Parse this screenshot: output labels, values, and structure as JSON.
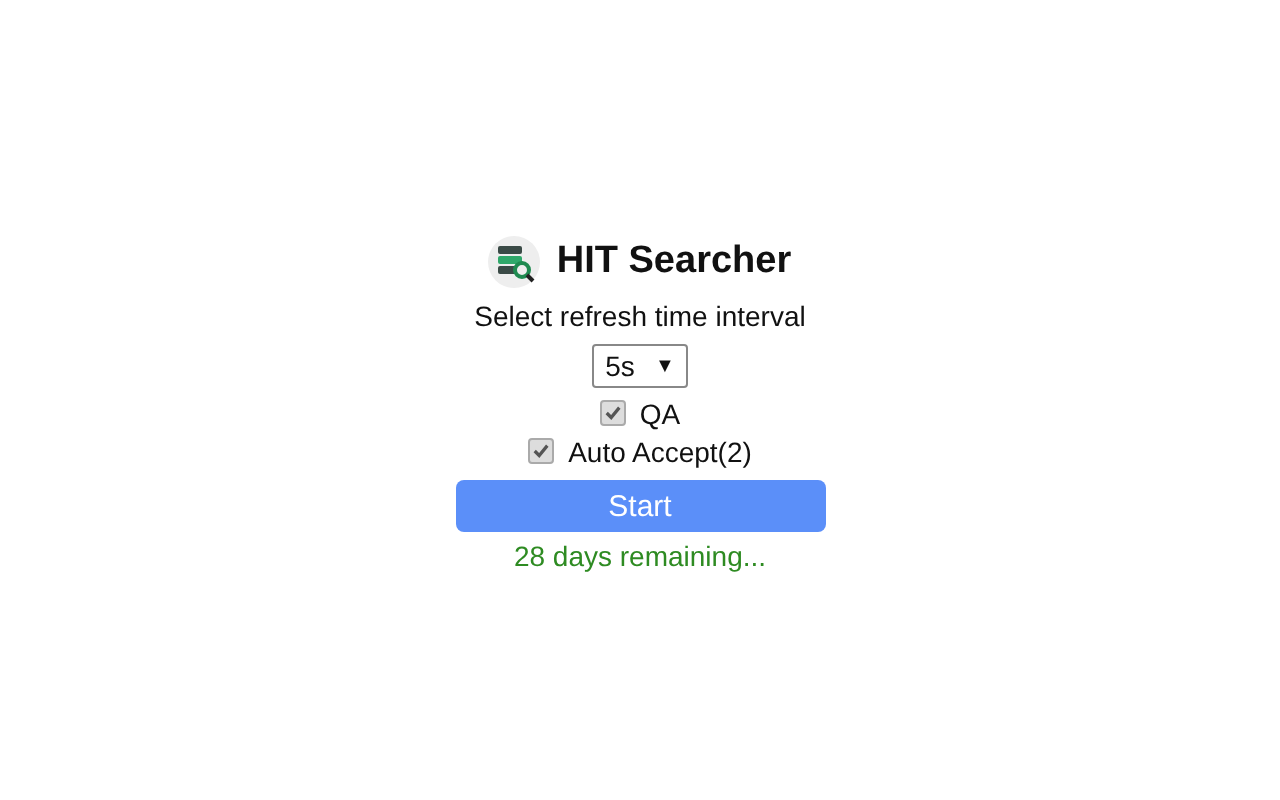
{
  "header": {
    "title": "HIT Searcher"
  },
  "interval": {
    "label": "Select refresh time interval",
    "value": "5s",
    "arrow": "▼"
  },
  "options": [
    {
      "label": "QA",
      "checked": true
    },
    {
      "label": "Auto Accept(2)",
      "checked": true
    }
  ],
  "start_button": {
    "label": "Start"
  },
  "status": "28 days remaining..."
}
